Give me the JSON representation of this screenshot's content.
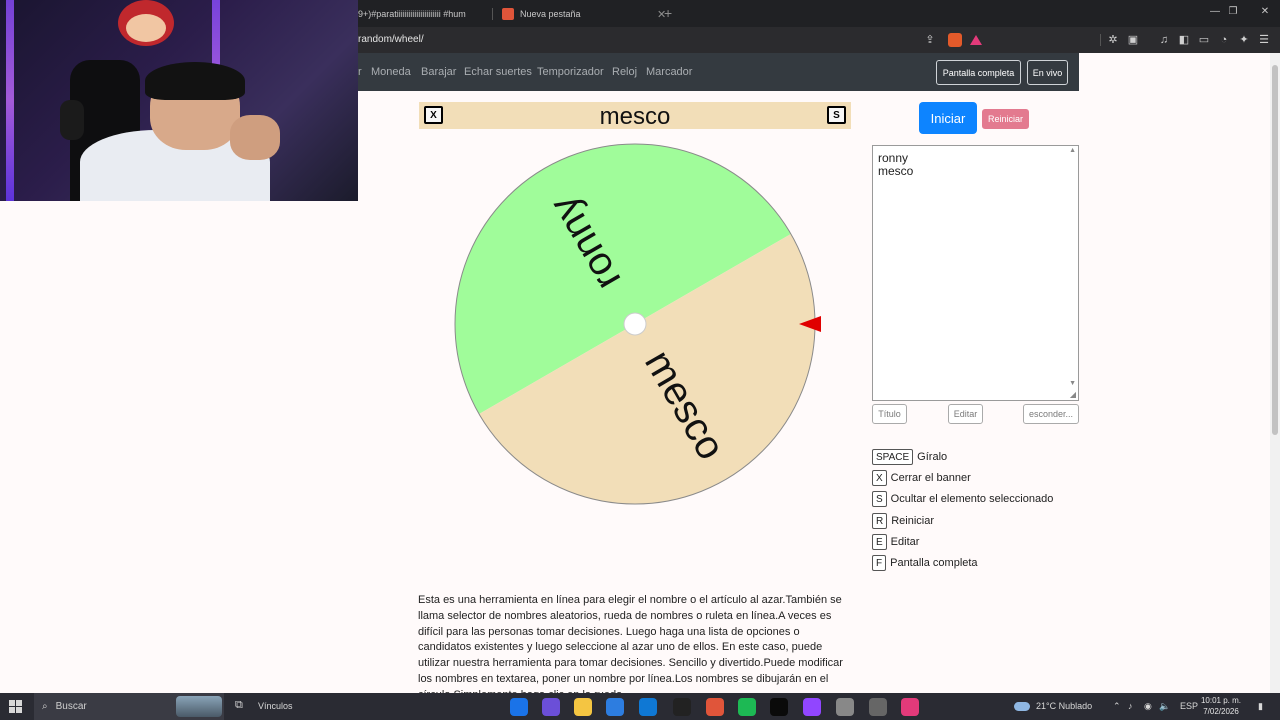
{
  "browser": {
    "tabs": [
      {
        "label": "9+)#paratiiiiiiiiiiiiiiiiiiiiii #hum"
      },
      {
        "label": "Nueva pestaña"
      }
    ],
    "url": "random/wheel/"
  },
  "navbar": {
    "links": [
      "r",
      "Moneda",
      "Barajar",
      "Echar suertes",
      "Temporizador",
      "Reloj",
      "Marcador"
    ],
    "fullscreen_label": "Pantalla completa",
    "live_label": "En vivo"
  },
  "banner": {
    "close_key": "X",
    "hide_key": "S",
    "selected_name": "mesco"
  },
  "wheel": {
    "segments": [
      {
        "label": "ronny",
        "color": "#a0fc9a"
      },
      {
        "label": "mesco",
        "color": "#f2deb8"
      }
    ],
    "pointer_color": "#e00000",
    "rotation_deg": -30
  },
  "controls": {
    "start_label": "Iniciar",
    "reset_label": "Reiniciar"
  },
  "names": [
    "ronny",
    "mesco"
  ],
  "names_buttons": {
    "title": "Título",
    "edit": "Editar",
    "hide": "esconder..."
  },
  "shortcuts": [
    {
      "key": "SPACE",
      "label": "Gíralo"
    },
    {
      "key": "X",
      "label": "Cerrar el banner"
    },
    {
      "key": "S",
      "label": "Ocultar el elemento seleccionado"
    },
    {
      "key": "R",
      "label": "Reiniciar"
    },
    {
      "key": "E",
      "label": "Editar"
    },
    {
      "key": "F",
      "label": "Pantalla completa"
    }
  ],
  "description": "Esta es una herramienta en línea para elegir el nombre o el artículo al azar.También se llama selector de nombres aleatorios, rueda de nombres o ruleta en línea.A veces es difícil para las personas tomar decisiones. Luego haga una lista de opciones o candidatos existentes y luego seleccione al azar uno de ellos. En este caso, puede utilizar nuestra herramienta para tomar decisiones. Sencillo y divertido.Puede modificar los nombres en textarea, poner un nombre por línea.Los nombres se dibujarán en el círculo.Simplemente haga clic en la rueda",
  "taskbar": {
    "search_placeholder": "Buscar",
    "links_label": "Vínculos",
    "weather": "21°C  Nublado",
    "language": "ESP",
    "time": "10:01 p. m.",
    "date": "7/02/2026",
    "app_colors": [
      "#1a73e8",
      "#6b4fd8",
      "#f4c542",
      "#2d7de0",
      "#0f78d4",
      "#222222",
      "#e0553a",
      "#1db954",
      "#0a0a0a",
      "#9146ff",
      "#888888",
      "#666666",
      "#e33a7a"
    ]
  }
}
